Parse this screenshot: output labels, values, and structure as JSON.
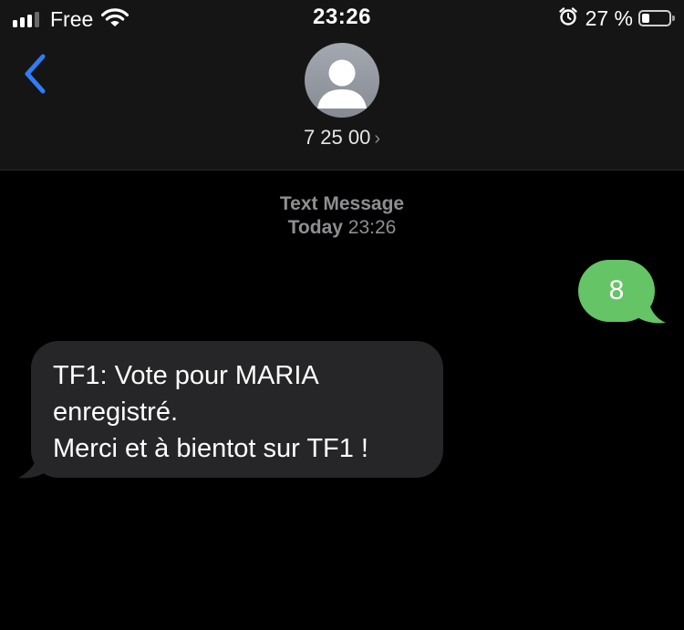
{
  "status_bar": {
    "carrier": "Free",
    "time": "23:26",
    "battery_percent_text": "27 %",
    "battery_level": 0.27,
    "signal_bars_active": 3,
    "signal_bars_total": 4,
    "icons": [
      "signal-icon",
      "wifi-icon",
      "alarm-icon",
      "battery-icon"
    ]
  },
  "nav": {
    "back_icon": "chevron-left-icon",
    "contact_avatar_icon": "person-silhouette-icon",
    "contact_number": "7 25 00",
    "contact_chevron": "›"
  },
  "conversation": {
    "meta": {
      "type": "Text Message",
      "day": "Today",
      "time": "23:26"
    },
    "messages": [
      {
        "direction": "outgoing",
        "text": "8",
        "color": "#65c466"
      },
      {
        "direction": "incoming",
        "lines": [
          "TF1: Vote pour MARIA",
          "enregistré.",
          "Merci et à bientot sur TF1 !"
        ],
        "color": "#262628"
      }
    ]
  },
  "colors": {
    "accent": "#2f7cf6",
    "header_bg": "#151515",
    "background": "#000000",
    "meta_text": "#8e8e93"
  }
}
